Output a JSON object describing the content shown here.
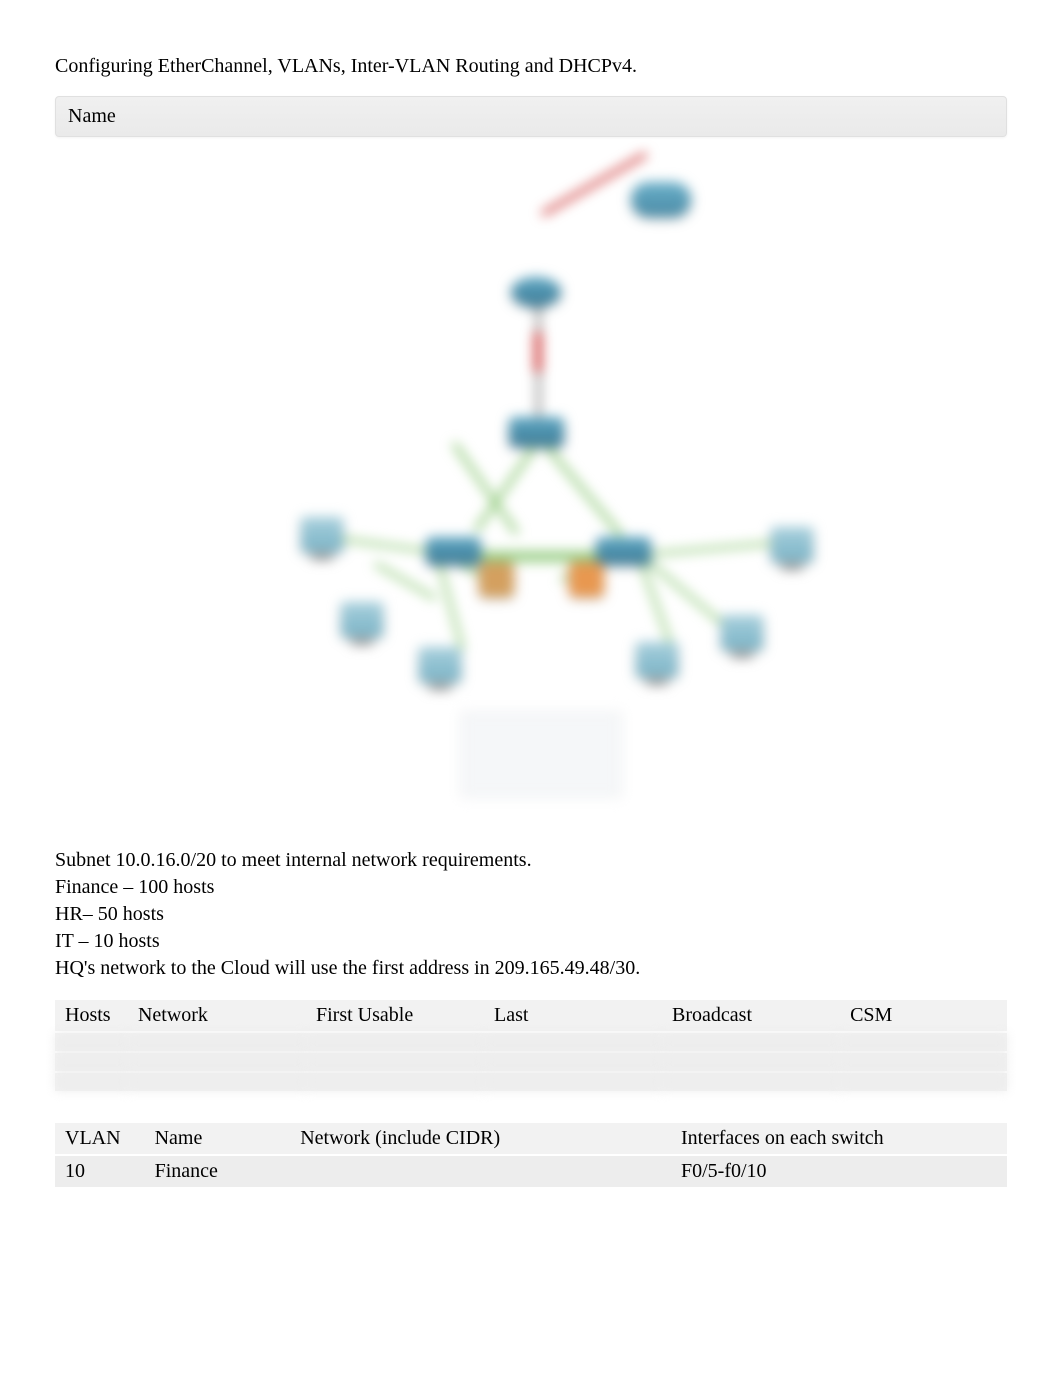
{
  "title": "Configuring EtherChannel, VLANs, Inter-VLAN Routing and DHCPv4.",
  "name_label": "Name",
  "requirements": {
    "line1": "Subnet 10.0.16.0/20 to meet internal network requirements.",
    "line2": "Finance – 100 hosts",
    "line3": "HR– 50 hosts",
    "line4": "IT – 10 hosts",
    "line5": "HQ's network to the Cloud will use the first address in 209.165.49.48/30."
  },
  "table1": {
    "headers": {
      "c1": "Hosts",
      "c2": "Network",
      "c3": "First Usable",
      "c4": "Last",
      "c5": "Broadcast",
      "c6": "CSM"
    }
  },
  "table2": {
    "headers": {
      "c1": "VLAN",
      "c2": "Name",
      "c3": "Network (include CIDR)",
      "c4": "Interfaces on each switch"
    },
    "rows": [
      {
        "vlan": "10",
        "name": "Finance",
        "network": "",
        "interfaces": "F0/5-f0/10"
      }
    ]
  }
}
